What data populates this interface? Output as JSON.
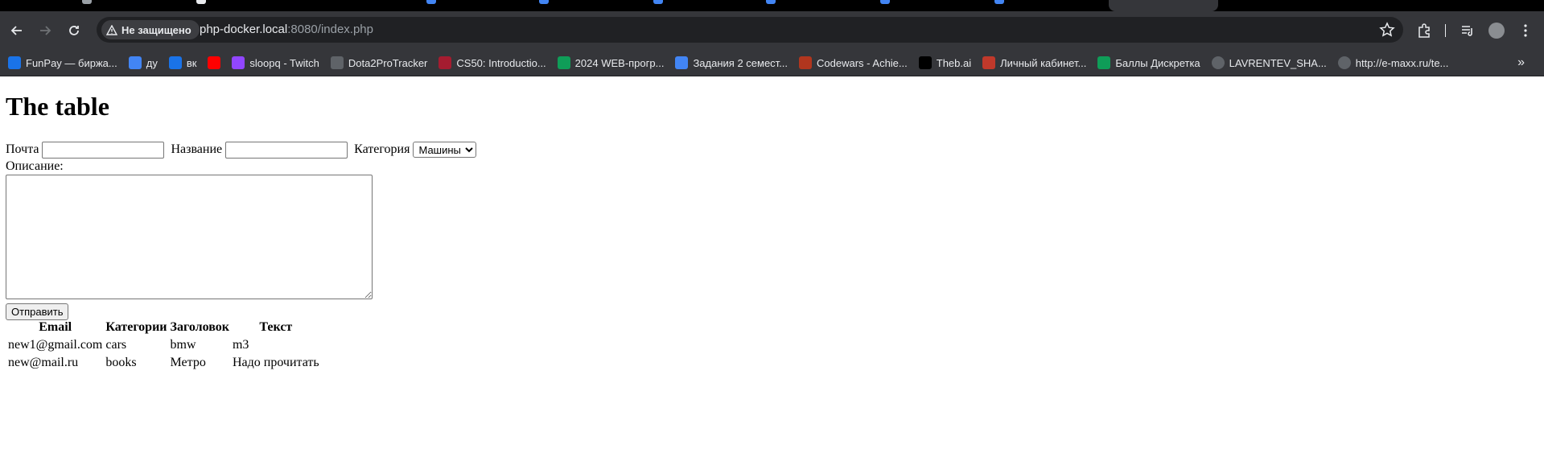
{
  "browser": {
    "security_label": "Не защищено",
    "url_host": "php-docker.local",
    "url_rest": ":8080/index.php",
    "bookmarks": [
      {
        "label": "FunPay — биржа...",
        "icon": "funpay-icon",
        "color": "#1a73e8"
      },
      {
        "label": "ду",
        "icon": "docs-icon",
        "color": "#4285f4"
      },
      {
        "label": "вк",
        "icon": "chat-icon",
        "color": "#1a73e8"
      },
      {
        "label": "",
        "icon": "youtube-icon",
        "color": "#ff0000"
      },
      {
        "label": "sloopq - Twitch",
        "icon": "twitch-icon",
        "color": "#9146ff"
      },
      {
        "label": "Dota2ProTracker",
        "icon": "dota-icon",
        "color": "#5f6368"
      },
      {
        "label": "CS50: Introductio...",
        "icon": "harvard-icon",
        "color": "#a51c30"
      },
      {
        "label": "2024 WEB-прогр...",
        "icon": "sheets-icon",
        "color": "#0f9d58"
      },
      {
        "label": "Задания 2 семест...",
        "icon": "docs-icon",
        "color": "#4285f4"
      },
      {
        "label": "Codewars - Achie...",
        "icon": "codewars-icon",
        "color": "#b1361e"
      },
      {
        "label": "Theb.ai",
        "icon": "theb-icon",
        "color": "#000000"
      },
      {
        "label": "Личный кабинет...",
        "icon": "cabinet-icon",
        "color": "#c0392b"
      },
      {
        "label": "Баллы Дискретка",
        "icon": "sheets-icon",
        "color": "#0f9d58"
      },
      {
        "label": "LAVRENTEV_SHA...",
        "icon": "globe-icon",
        "color": "#5f6368"
      },
      {
        "label": "http://e-maxx.ru/te...",
        "icon": "globe-icon",
        "color": "#5f6368"
      }
    ],
    "more_symbol": "»"
  },
  "page": {
    "title": "The table",
    "form": {
      "email_label": "Почта",
      "email_value": "",
      "title_label": "Название",
      "title_value": "",
      "category_label": "Категория",
      "category_selected": "Машины",
      "description_label": "Описание:",
      "description_value": "",
      "submit_label": "Отправить"
    },
    "table": {
      "headers": [
        "Email",
        "Категории",
        "Заголовок",
        "Текст"
      ],
      "rows": [
        [
          "new1@gmail.com",
          "cars",
          "bmw",
          "m3"
        ],
        [
          "new@mail.ru",
          "books",
          "Метро",
          "Надо прочитать"
        ]
      ]
    }
  }
}
